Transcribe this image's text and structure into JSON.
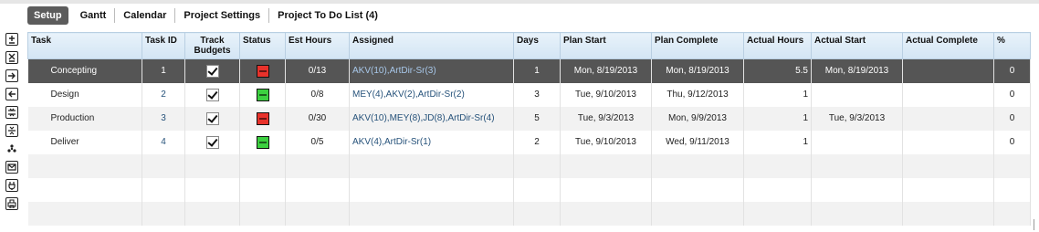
{
  "tabs": [
    {
      "label": "Setup",
      "active": true
    },
    {
      "label": "Gantt",
      "active": false
    },
    {
      "label": "Calendar",
      "active": false
    },
    {
      "label": "Project Settings",
      "active": false
    },
    {
      "label": "Project To Do List (4)",
      "active": false
    }
  ],
  "toolbar": [
    "add-row-icon",
    "delete-row-icon",
    "indent-icon",
    "outdent-icon",
    "expand-icon",
    "collapse-icon",
    "network-icon",
    "email-icon",
    "plug-icon",
    "print-icon"
  ],
  "columns": [
    "Task",
    "Task ID",
    "Track Budgets",
    "Status",
    "Est Hours",
    "Assigned",
    "Days",
    "Plan Start",
    "Plan Complete",
    "Actual Hours",
    "Actual Start",
    "Actual Complete",
    "%"
  ],
  "rows": [
    {
      "task": "Concepting",
      "id": "1",
      "track": true,
      "status": "red",
      "est": "0/13",
      "assigned": "AKV(10),ArtDir-Sr(3)",
      "days": "1",
      "plan_start": "Mon, 8/19/2013",
      "plan_complete": "Mon, 8/19/2013",
      "actual_hours": "5.5",
      "actual_start": "Mon, 8/19/2013",
      "actual_complete": "",
      "pct": "0"
    },
    {
      "task": "Design",
      "id": "2",
      "track": true,
      "status": "green",
      "est": "0/8",
      "assigned": "MEY(4),AKV(2),ArtDir-Sr(2)",
      "days": "3",
      "plan_start": "Tue, 9/10/2013",
      "plan_complete": "Thu, 9/12/2013",
      "actual_hours": "1",
      "actual_start": "",
      "actual_complete": "",
      "pct": "0"
    },
    {
      "task": "Production",
      "id": "3",
      "track": true,
      "status": "red",
      "est": "0/30",
      "assigned": "AKV(10),MEY(8),JD(8),ArtDir-Sr(4)",
      "days": "5",
      "plan_start": "Tue, 9/3/2013",
      "plan_complete": "Mon, 9/9/2013",
      "actual_hours": "1",
      "actual_start": "Tue, 9/3/2013",
      "actual_complete": "",
      "pct": "0"
    },
    {
      "task": "Deliver",
      "id": "4",
      "track": true,
      "status": "green",
      "est": "0/5",
      "assigned": "AKV(4),ArtDir-Sr(1)",
      "days": "2",
      "plan_start": "Tue, 9/10/2013",
      "plan_complete": "Wed, 9/11/2013",
      "actual_hours": "1",
      "actual_start": "",
      "actual_complete": "",
      "pct": "0"
    }
  ],
  "colors": {
    "header_bg": "#d3e5f4",
    "selected_row": "#555555",
    "status_red": "#e8322b",
    "status_green": "#3cd040",
    "active_tab": "#5c5c5c"
  }
}
